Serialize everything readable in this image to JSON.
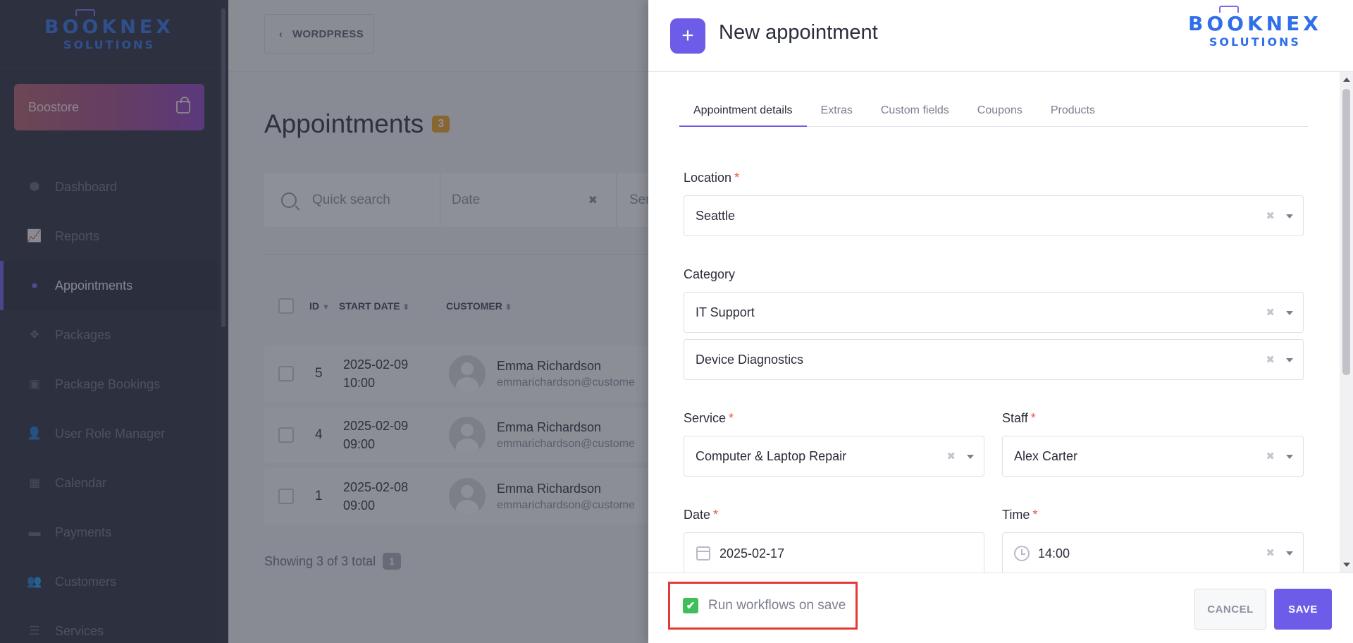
{
  "brand": {
    "line1": "BOOKNEX",
    "line2": "SOLUTIONS",
    "primary_color": "#2f6fe9",
    "accent_color": "#6c5ce7"
  },
  "sidebar": {
    "store_button": "Boostore",
    "items": [
      {
        "label": "Dashboard",
        "icon": "cube-icon"
      },
      {
        "label": "Reports",
        "icon": "chart-icon"
      },
      {
        "label": "Appointments",
        "icon": "clock-icon",
        "active": true
      },
      {
        "label": "Packages",
        "icon": "boxes-icon"
      },
      {
        "label": "Package Bookings",
        "icon": "gift-icon"
      },
      {
        "label": "User Role Manager",
        "icon": "user-plus-icon"
      },
      {
        "label": "Calendar",
        "icon": "calendar-icon"
      },
      {
        "label": "Payments",
        "icon": "wallet-icon"
      },
      {
        "label": "Customers",
        "icon": "users-icon"
      },
      {
        "label": "Services",
        "icon": "list-icon"
      }
    ]
  },
  "main": {
    "back_button": "WORDPRESS",
    "title": "Appointments",
    "count": "3",
    "filters": {
      "search_placeholder": "Quick search",
      "date_placeholder": "Date",
      "service_placeholder": "Ser"
    },
    "columns": {
      "id": "ID",
      "start_date": "START DATE",
      "customer": "CUSTOMER"
    },
    "rows": [
      {
        "id": "5",
        "date": "2025-02-09",
        "time": "10:00",
        "name": "Emma Richardson",
        "email": "emmarichardson@custome"
      },
      {
        "id": "4",
        "date": "2025-02-09",
        "time": "09:00",
        "name": "Emma Richardson",
        "email": "emmarichardson@custome"
      },
      {
        "id": "1",
        "date": "2025-02-08",
        "time": "09:00",
        "name": "Emma Richardson",
        "email": "emmarichardson@custome"
      }
    ],
    "showing": "Showing 3 of 3 total",
    "page": "1"
  },
  "drawer": {
    "title": "New appointment",
    "tabs": [
      "Appointment details",
      "Extras",
      "Custom fields",
      "Coupons",
      "Products"
    ],
    "location": {
      "label": "Location",
      "value": "Seattle"
    },
    "category": {
      "label": "Category",
      "value": "IT Support",
      "sub_value": "Device Diagnostics"
    },
    "service": {
      "label": "Service",
      "value": "Computer & Laptop Repair"
    },
    "staff": {
      "label": "Staff",
      "value": "Alex Carter"
    },
    "date": {
      "label": "Date",
      "value": "2025-02-17"
    },
    "time": {
      "label": "Time",
      "value": "14:00"
    },
    "run_workflows": {
      "label": "Run workflows on save",
      "checked": true
    },
    "cancel": "CANCEL",
    "save": "SAVE"
  }
}
